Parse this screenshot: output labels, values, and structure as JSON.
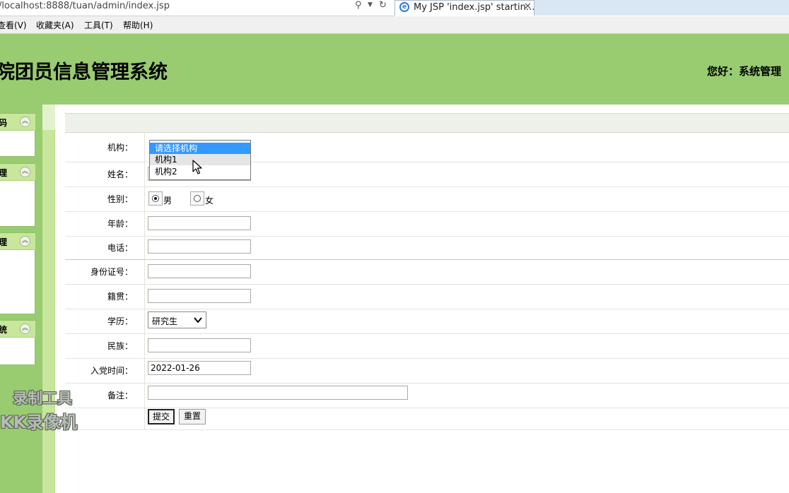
{
  "browser": {
    "address": "/localhost:8888/tuan/admin/index.jsp",
    "tab_title": "My JSP 'index.jsp' startin...",
    "tab_close": "✕",
    "menu": [
      "查看(V)",
      "收藏夹(A)",
      "工具(T)",
      "帮助(H)"
    ]
  },
  "header": {
    "system_title": "院团员信息管理系统",
    "greeting": "您好：系统管理"
  },
  "sidebar": {
    "panels": [
      {
        "label": "码",
        "icon": "collapse-up-icon"
      },
      {
        "label": "理",
        "icon": "collapse-up-icon"
      },
      {
        "label": "理",
        "icon": "collapse-up-icon"
      },
      {
        "label": "统",
        "icon": "collapse-up-icon"
      }
    ]
  },
  "form": {
    "labels": {
      "org": "机构：",
      "name": "姓名：",
      "gender": "性别：",
      "age": "年龄：",
      "phone": "电话：",
      "id_card": "身份证号：",
      "hometown": "籍贯：",
      "education": "学历：",
      "ethnicity": "民族：",
      "join_date": "入党时间：",
      "remark": "备注："
    },
    "org_options": [
      "请选择机构",
      "机构1",
      "机构2"
    ],
    "org_selected_index": 0,
    "org_hover_index": 1,
    "gender_options": [
      "男",
      "女"
    ],
    "gender_selected": "男",
    "education_value": "研究生",
    "join_date_value": "2022-01-26",
    "submit_label": "提交",
    "reset_label": "重置"
  },
  "watermark": {
    "line1": "录制工具",
    "line2": "KK录像机"
  },
  "colors": {
    "header_green": "#99cc70",
    "panel_head_green": "#c8e69c",
    "selection_blue": "#3399ff"
  }
}
